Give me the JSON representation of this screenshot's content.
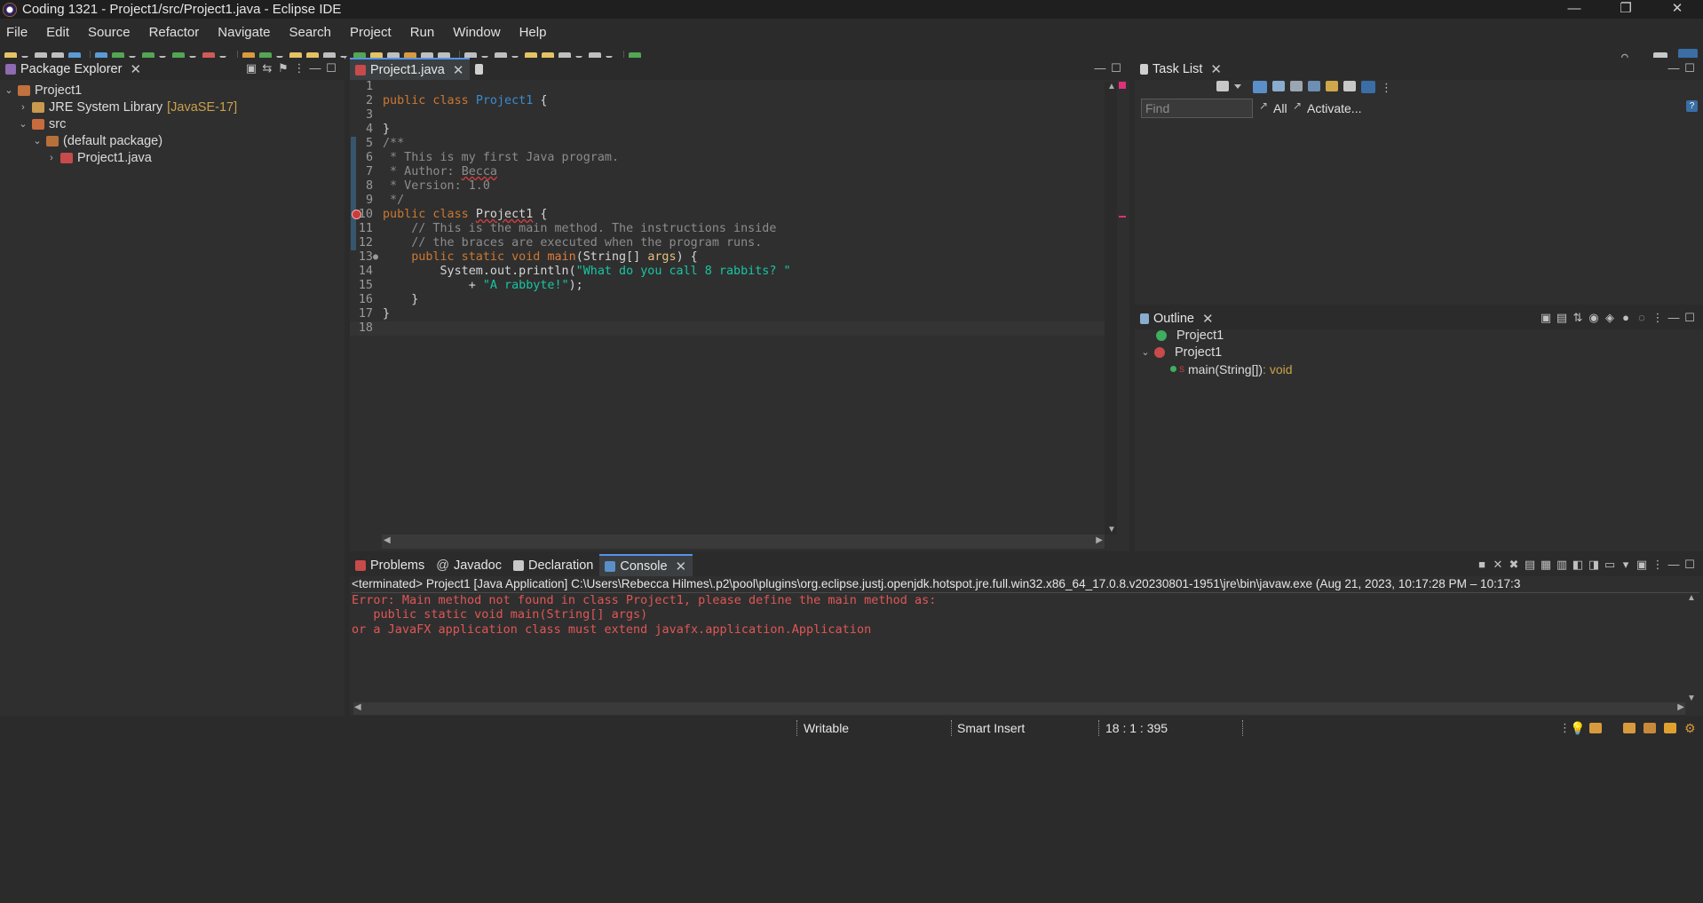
{
  "window": {
    "title": "Coding 1321 - Project1/src/Project1.java - Eclipse IDE",
    "controls": [
      "—",
      "❐",
      "✕"
    ]
  },
  "menu": [
    "File",
    "Edit",
    "Source",
    "Refactor",
    "Navigate",
    "Search",
    "Project",
    "Run",
    "Window",
    "Help"
  ],
  "package_explorer": {
    "tab_label": "Package Explorer",
    "tree": [
      {
        "label": "Project1",
        "decor": ""
      },
      {
        "label": "JRE System Library",
        "decor": "[JavaSE-17]"
      },
      {
        "label": "src",
        "decor": ""
      },
      {
        "label": "(default package)",
        "decor": ""
      },
      {
        "label": "Project1.java",
        "decor": ""
      }
    ]
  },
  "editor": {
    "tab_label": "Project1.java",
    "lines": [
      "1",
      "2",
      "3",
      "4",
      "5",
      "6",
      "7",
      "8",
      "9",
      "10",
      "11",
      "12",
      "13",
      "14",
      "15",
      "16",
      "17",
      "18"
    ],
    "code": {
      "l2": [
        "public class ",
        "Project1",
        " {"
      ],
      "l4": "}",
      "l5": "/**",
      "l6": " * This is my first Java program.",
      "l7a": " * Author: ",
      "l7b": "Becca",
      "l8": " * Version: 1.0",
      "l9": " */",
      "l10a": "public class ",
      "l10b": "Project1",
      "l10c": " {",
      "l11": "    // This is the main method. The instructions inside",
      "l12": "    // the braces are executed when the program runs.",
      "l13a": "    public static void ",
      "l13b": "main",
      "l13c": "(String[] ",
      "l13d": "args",
      "l13e": ") {",
      "l14a": "        System.out.println(",
      "l14b": "\"What do you call 8 rabbits? \"",
      "l15a": "            + ",
      "l15b": "\"A rabbyte!\"",
      "l15c": ");",
      "l16": "    }",
      "l17": "}"
    }
  },
  "task_list": {
    "tab_label": "Task List",
    "find_placeholder": "Find",
    "all": "All",
    "activate": "Activate..."
  },
  "outline": {
    "tab_label": "Outline",
    "items": [
      {
        "label": "Project1"
      },
      {
        "label": "Project1"
      },
      {
        "label": "main(String[])",
        "type": " : void"
      }
    ]
  },
  "console": {
    "tabs": [
      "Problems",
      "Javadoc",
      "Declaration",
      "Console"
    ],
    "header": "<terminated> Project1 [Java Application] C:\\Users\\Rebecca Hilmes\\.p2\\pool\\plugins\\org.eclipse.justj.openjdk.hotspot.jre.full.win32.x86_64_17.0.8.v20230801-1951\\jre\\bin\\javaw.exe  (Aug 21, 2023, 10:17:28 PM – 10:17:3",
    "output": [
      "Error: Main method not found in class Project1, please define the main method as:",
      "   public static void main(String[] args)",
      "or a JavaFX application class must extend javafx.application.Application"
    ]
  },
  "status": {
    "writable": "Writable",
    "insert_mode": "Smart Insert",
    "position": "18 : 1 : 395"
  },
  "colors": {
    "error": "#e05656",
    "string": "#17c6a3",
    "keyword": "#cc7832",
    "class": "#3b8bd0"
  }
}
